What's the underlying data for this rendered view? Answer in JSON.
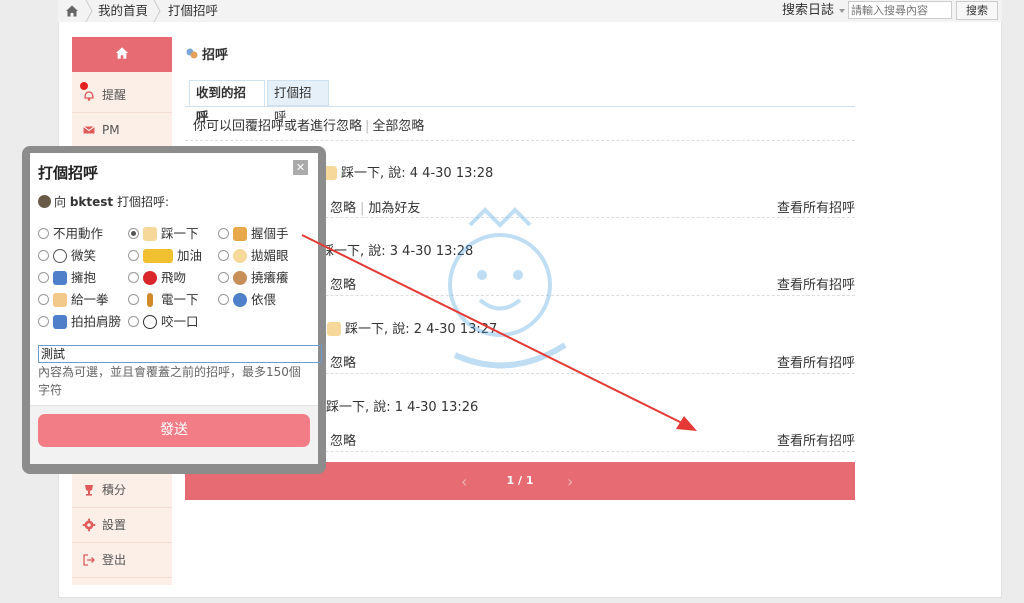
{
  "breadcrumb": {
    "home": "我的首頁",
    "current": "打個招呼"
  },
  "search": {
    "type": "搜索日誌",
    "placeholder": "請輸入搜尋內容",
    "button": "搜索"
  },
  "sidebar": {
    "items": [
      {
        "label": "提醒",
        "icon": "bell-icon"
      },
      {
        "label": "PM",
        "icon": "mail-icon"
      },
      {
        "label": "積分",
        "icon": "trophy-icon"
      },
      {
        "label": "設置",
        "icon": "gear-icon"
      },
      {
        "label": "登出",
        "icon": "logout-icon"
      }
    ]
  },
  "main": {
    "title": "招呼",
    "tabs": [
      {
        "label": "收到的招呼"
      },
      {
        "label": "打個招呼"
      }
    ],
    "note": {
      "text": "你可以回覆招呼或者進行忽略",
      "link": "全部忽略"
    },
    "entries": [
      {
        "text": "踩一下, 說: 4  4-30 13:28",
        "actions": [
          "忽略",
          "加為好友"
        ],
        "view_all": "查看所有招呼"
      },
      {
        "text": "踩一下, 說: 3  4-30 13:28",
        "actions": [
          "忽略"
        ],
        "view_all": "查看所有招呼"
      },
      {
        "text": "踩一下, 說: 2  4-30 13:27",
        "actions": [
          "忽略"
        ],
        "view_all": "查看所有招呼"
      },
      {
        "text": "踩一下, 說: 1  4-30 13:26",
        "actions": [
          "忽略"
        ],
        "view_all": "查看所有招呼"
      }
    ],
    "pager": {
      "text": "1 / 1"
    }
  },
  "dialog": {
    "title": "打個招呼",
    "to_prefix": "向",
    "to_user": "bktest",
    "to_suffix": "打個招呼:",
    "options": [
      {
        "label": "不用動作",
        "checked": false
      },
      {
        "label": "踩一下",
        "checked": true
      },
      {
        "label": "握個手",
        "checked": false
      },
      {
        "label": "微笑",
        "checked": false
      },
      {
        "label": "加油",
        "checked": false
      },
      {
        "label": "拋媚眼",
        "checked": false
      },
      {
        "label": "擁抱",
        "checked": false
      },
      {
        "label": "飛吻",
        "checked": false
      },
      {
        "label": "撓癢癢",
        "checked": false
      },
      {
        "label": "給一拳",
        "checked": false
      },
      {
        "label": "電一下",
        "checked": false
      },
      {
        "label": "依偎",
        "checked": false
      },
      {
        "label": "拍拍肩膀",
        "checked": false
      },
      {
        "label": "咬一口",
        "checked": false
      }
    ],
    "input_value": "測試",
    "hint": "內容為可選，並且會覆蓋之前的招呼，最多150個字符",
    "send": "發送"
  },
  "colors": {
    "accent": "#e76b72",
    "send": "#f37d86",
    "sidebar_bg": "#fcefe8",
    "annotation_arrow": "#e53935"
  }
}
